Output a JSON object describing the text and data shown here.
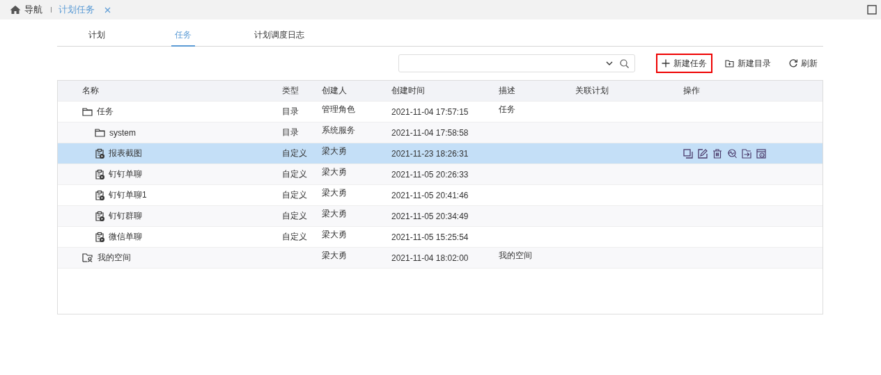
{
  "nav_bar": {
    "home_label": "导航",
    "tabs": [
      {
        "label": "计划任务",
        "selected": true,
        "closable": true
      }
    ]
  },
  "tabs": [
    {
      "label": "计划",
      "selected": false
    },
    {
      "label": "任务",
      "selected": true
    },
    {
      "label": "计划调度日志",
      "selected": false
    }
  ],
  "toolbar": {
    "buttons": [
      {
        "kind": "new-task",
        "label": "新建任务",
        "highlighted": true
      },
      {
        "kind": "new-folder",
        "label": "新建目录",
        "highlighted": false
      },
      {
        "kind": "refresh",
        "label": "刷新",
        "highlighted": false
      }
    ]
  },
  "table": {
    "columns": [
      "名称",
      "类型",
      "创建人",
      "创建时间",
      "描述",
      "关联计划",
      "操作"
    ],
    "rows": [
      {
        "kind": "folder",
        "name": "任务",
        "type": "目录",
        "creator": "管理角色",
        "created": "2021-11-04 17:57:15",
        "description": "任务",
        "selected": false,
        "children": [
          {
            "kind": "folder",
            "name": "system",
            "type": "目录",
            "creator": "系统服务",
            "created": "2021-11-04 17:58:58",
            "selected": false
          },
          {
            "kind": "task",
            "name": "报表截图",
            "type": "自定义",
            "creator": "梁大勇",
            "created": "2021-11-23 18:26:31",
            "selected": true
          },
          {
            "kind": "task",
            "name": "钉钉单聊",
            "type": "自定义",
            "creator": "梁大勇",
            "created": "2021-11-05 20:26:33",
            "selected": false
          },
          {
            "kind": "task",
            "name": "钉钉单聊1",
            "type": "自定义",
            "creator": "梁大勇",
            "created": "2021-11-05 20:41:46",
            "selected": false
          },
          {
            "kind": "task",
            "name": "钉钉群聊",
            "type": "自定义",
            "creator": "梁大勇",
            "created": "2021-11-05 20:34:49",
            "selected": false
          },
          {
            "kind": "task",
            "name": "微信单聊",
            "type": "自定义",
            "creator": "梁大勇",
            "created": "2021-11-05 15:25:54",
            "selected": false
          }
        ]
      },
      {
        "kind": "space",
        "name": "我的空间",
        "creator": "梁大勇",
        "created": "2021-11-04 18:02:00",
        "description": "我的空间",
        "selected": false
      }
    ]
  }
}
